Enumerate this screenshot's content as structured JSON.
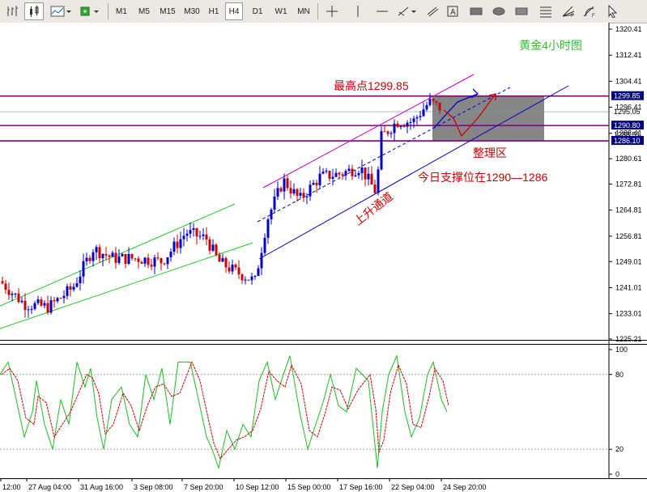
{
  "toolbar": {
    "timeframes": [
      "M1",
      "M5",
      "M15",
      "M30",
      "H1",
      "H4",
      "D1",
      "W1",
      "MN"
    ],
    "active_timeframe": "H4",
    "tools": [
      "cursor",
      "crosshair",
      "vertical-line",
      "horizontal-line",
      "trend-line",
      "channel",
      "fibonacci",
      "text",
      "label",
      "rectangle",
      "ellipse",
      "triangle",
      "arrow",
      "fibonacci-arrow",
      "fibonacci-arrow-2",
      "arrow-select"
    ]
  },
  "chart": {
    "title": "黄金4小时图",
    "annotation_high": "最高点1299.85",
    "annotation_zone": "整理区",
    "annotation_support": "今日支撑位在1290—1286",
    "annotation_channel": "上升通道",
    "price_axis": [
      "1320.41",
      "1312.41",
      "1304.41",
      "1296.41",
      "1288.41",
      "1280.61",
      "1272.81",
      "1264.81",
      "1256.81",
      "1249.01",
      "1241.01",
      "1233.01",
      "1225.21"
    ],
    "highlight_labels": [
      {
        "text": "1299.85",
        "value": 1299.85
      },
      {
        "text": "1295.05",
        "value": 1295.05
      },
      {
        "text": "1290.80",
        "value": 1290.8
      },
      {
        "text": "1288.51",
        "value": 1288.51
      },
      {
        "text": "1286.10",
        "value": 1286.1
      }
    ],
    "indicator_axis": [
      "100",
      "80",
      "20",
      "0"
    ],
    "time_axis": [
      "12:00",
      "27 Aug 04:00",
      "31 Aug 16:00",
      "3 Sep 08:00",
      "7 Sep 20:00",
      "10 Sep 12:00",
      "15 Sep 00:00",
      "17 Sep 16:00",
      "22 Sep 04:00",
      "24 Sep 20:00"
    ],
    "colors": {
      "bull": "#0000c8",
      "bear": "#cc0000",
      "level_line": "#800080",
      "green_channel": "#22cc22",
      "blue_channel": "#0000cc",
      "annotation": "#cc0000",
      "title": "#33bb33",
      "zone_fill": "#808080",
      "label_bg": "#000080",
      "stoch_main": "#22bb22",
      "stoch_signal": "#cc0000"
    }
  }
}
